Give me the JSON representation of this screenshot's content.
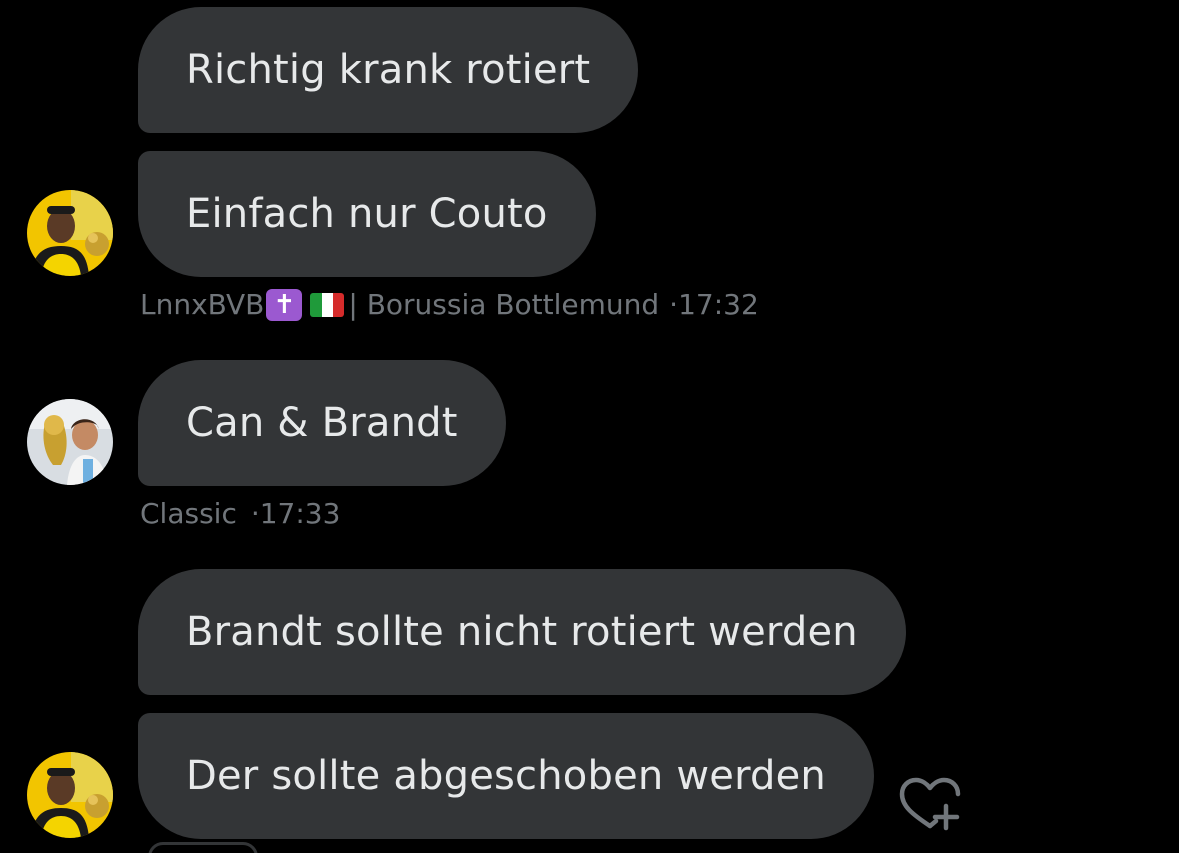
{
  "messages": [
    {
      "text": "Richtig krank rotiert"
    },
    {
      "text": "Einfach nur Couto"
    },
    {
      "text": "Can & Brandt"
    },
    {
      "text": "Brandt sollte nicht rotiert werden"
    },
    {
      "text": "Der sollte abgeschoben werden"
    }
  ],
  "meta1": {
    "name_prefix": "LnnxBVB",
    "cross_emoji": "✝",
    "name_suffix": "| Borussia Bottlemund",
    "time": "·17:32"
  },
  "meta2": {
    "name": "Classic",
    "time": "·17:33"
  },
  "colors": {
    "background": "#000000",
    "bubble": "#333537",
    "bubble_text": "#e7e9ea",
    "meta_text": "#71767b"
  },
  "icons": {
    "react": "heart-plus-icon"
  }
}
